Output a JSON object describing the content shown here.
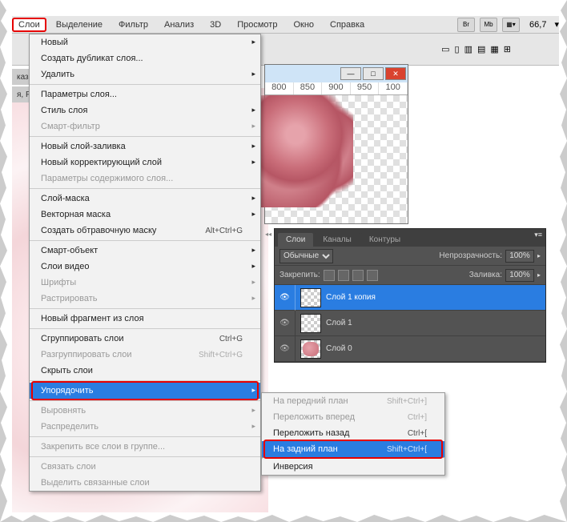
{
  "menubar": {
    "items": [
      "Слои",
      "Выделение",
      "Фильтр",
      "Анализ",
      "3D",
      "Просмотр",
      "Окно",
      "Справка"
    ],
    "toolbtns": [
      "Br",
      "Mb"
    ],
    "zoom": "66,7",
    "arrow": "▾"
  },
  "tab_frag": "каз..",
  "tab_frag2": "я, Р",
  "ruler": [
    "800",
    "850",
    "900",
    "950",
    "100"
  ],
  "menu": [
    {
      "label": "Новый",
      "sub": true
    },
    {
      "label": "Создать дубликат слоя..."
    },
    {
      "label": "Удалить",
      "sub": true
    },
    {
      "hr": true
    },
    {
      "label": "Параметры слоя..."
    },
    {
      "label": "Стиль слоя",
      "sub": true
    },
    {
      "label": "Смарт-фильтр",
      "sub": true,
      "disabled": true
    },
    {
      "hr": true
    },
    {
      "label": "Новый слой-заливка",
      "sub": true
    },
    {
      "label": "Новый корректирующий слой",
      "sub": true
    },
    {
      "label": "Параметры содержимого слоя...",
      "disabled": true
    },
    {
      "hr": true
    },
    {
      "label": "Слой-маска",
      "sub": true
    },
    {
      "label": "Векторная маска",
      "sub": true
    },
    {
      "label": "Создать обтравочную маску",
      "shortcut": "Alt+Ctrl+G"
    },
    {
      "hr": true
    },
    {
      "label": "Смарт-объект",
      "sub": true
    },
    {
      "label": "Слои видео",
      "sub": true
    },
    {
      "label": "Шрифты",
      "sub": true,
      "disabled": true
    },
    {
      "label": "Растрировать",
      "sub": true,
      "disabled": true
    },
    {
      "hr": true
    },
    {
      "label": "Новый фрагмент из слоя"
    },
    {
      "hr": true
    },
    {
      "label": "Сгруппировать слои",
      "shortcut": "Ctrl+G"
    },
    {
      "label": "Разгруппировать слои",
      "shortcut": "Shift+Ctrl+G",
      "disabled": true
    },
    {
      "label": "Скрыть слои"
    },
    {
      "hr": true
    },
    {
      "label": "Упорядочить",
      "sub": true,
      "highlight": true,
      "boxed": true
    },
    {
      "hr": true
    },
    {
      "label": "Выровнять",
      "sub": true,
      "disabled": true
    },
    {
      "label": "Распределить",
      "sub": true,
      "disabled": true
    },
    {
      "hr": true
    },
    {
      "label": "Закрепить все слои в группе...",
      "disabled": true
    },
    {
      "hr": true
    },
    {
      "label": "Связать слои",
      "disabled": true
    },
    {
      "label": "Выделить связанные слои",
      "disabled": true
    }
  ],
  "submenu": [
    {
      "label": "На передний план",
      "shortcut": "Shift+Ctrl+]",
      "disabled": true
    },
    {
      "label": "Переложить вперед",
      "shortcut": "Ctrl+]",
      "disabled": true
    },
    {
      "label": "Переложить назад",
      "shortcut": "Ctrl+["
    },
    {
      "label": "На задний план",
      "shortcut": "Shift+Ctrl+[",
      "highlight": true,
      "boxed": true
    },
    {
      "hr": true
    },
    {
      "label": "Инверсия"
    }
  ],
  "panel": {
    "tabs": [
      "Слои",
      "Каналы",
      "Контуры"
    ],
    "blend_mode": "Обычные",
    "opacity_label": "Непрозрачность:",
    "opacity": "100%",
    "lock_label": "Закрепить:",
    "fill_label": "Заливка:",
    "fill": "100%",
    "layers": [
      {
        "name": "Слой 1 копия",
        "active": true
      },
      {
        "name": "Слой 1"
      },
      {
        "name": "Слой 0",
        "pink": true
      }
    ]
  }
}
